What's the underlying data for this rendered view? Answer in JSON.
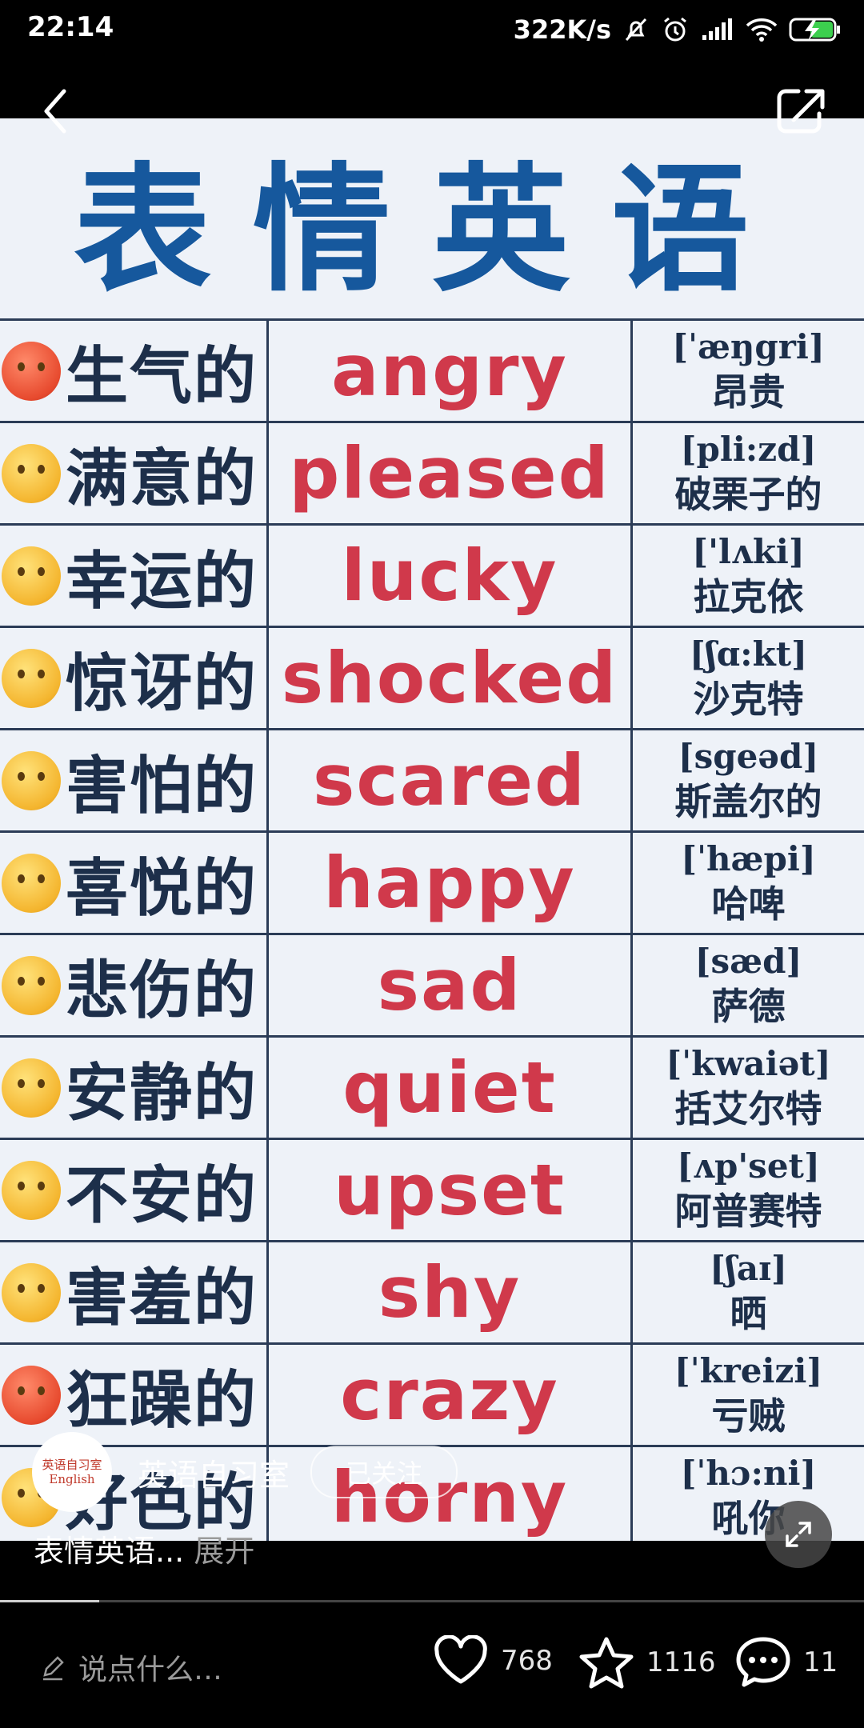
{
  "status_bar": {
    "time": "22:14",
    "network_speed": "322K/s"
  },
  "poster": {
    "title": "表情英语",
    "rows": [
      {
        "zh": "生气的",
        "en": "angry",
        "ipa": "[ˈæŋgri]",
        "homophone": "昂贵",
        "emoji": "angry-face-icon",
        "tone": "red"
      },
      {
        "zh": "满意的",
        "en": "pleased",
        "ipa": "[pli:zd]",
        "homophone": "破栗子的",
        "emoji": "smiling-face-icon",
        "tone": "yellow"
      },
      {
        "zh": "幸运的",
        "en": "lucky",
        "ipa": "['lʌki]",
        "homophone": "拉克依",
        "emoji": "halo-face-icon",
        "tone": "yellow"
      },
      {
        "zh": "惊讶的",
        "en": "shocked",
        "ipa": "[ʃɑ:kt]",
        "homophone": "沙克特",
        "emoji": "screaming-face-icon",
        "tone": "yellow"
      },
      {
        "zh": "害怕的",
        "en": "scared",
        "ipa": "[sgeəd]",
        "homophone": "斯盖尔的",
        "emoji": "anxious-face-icon",
        "tone": "yellow"
      },
      {
        "zh": "喜悦的",
        "en": "happy",
        "ipa": "[ˈhæpi]",
        "homophone": "哈啤",
        "emoji": "tongue-face-icon",
        "tone": "yellow"
      },
      {
        "zh": "悲伤的",
        "en": "sad",
        "ipa": "[sæd]",
        "homophone": "萨德",
        "emoji": "tears-of-joy-face-icon",
        "tone": "yellow"
      },
      {
        "zh": "安静的",
        "en": "quiet",
        "ipa": "[ˈkwaiət]",
        "homophone": "括艾尔特",
        "emoji": "shushing-face-icon",
        "tone": "yellow"
      },
      {
        "zh": "不安的",
        "en": "upset",
        "ipa": "[ʌp'set]",
        "homophone": "阿普赛特",
        "emoji": "pleading-face-icon",
        "tone": "yellow"
      },
      {
        "zh": "害羞的",
        "en": "shy",
        "ipa": "[ʃaɪ]",
        "homophone": "晒",
        "emoji": "blushing-face-icon",
        "tone": "yellow"
      },
      {
        "zh": "狂躁的",
        "en": "crazy",
        "ipa": "[ˈkreizi]",
        "homophone": "亏贼",
        "emoji": "pouting-face-icon",
        "tone": "red"
      },
      {
        "zh": "好色的",
        "en": "horny",
        "ipa": "[ˈhɔ:ni]",
        "homophone": "吼你",
        "emoji": "heart-eyes-face-icon",
        "tone": "yellow"
      }
    ]
  },
  "author": {
    "name": "英语自习室",
    "avatar_text_top": "英语自习室",
    "avatar_text_bottom": "English",
    "follow_label": "已关注"
  },
  "caption": {
    "text": "表情英语...",
    "more_label": "展开"
  },
  "progress": {
    "fraction": 0.115
  },
  "bottom_bar": {
    "comment_placeholder": "说点什么…",
    "likes": "768",
    "favorites": "1116",
    "comments": "11"
  }
}
